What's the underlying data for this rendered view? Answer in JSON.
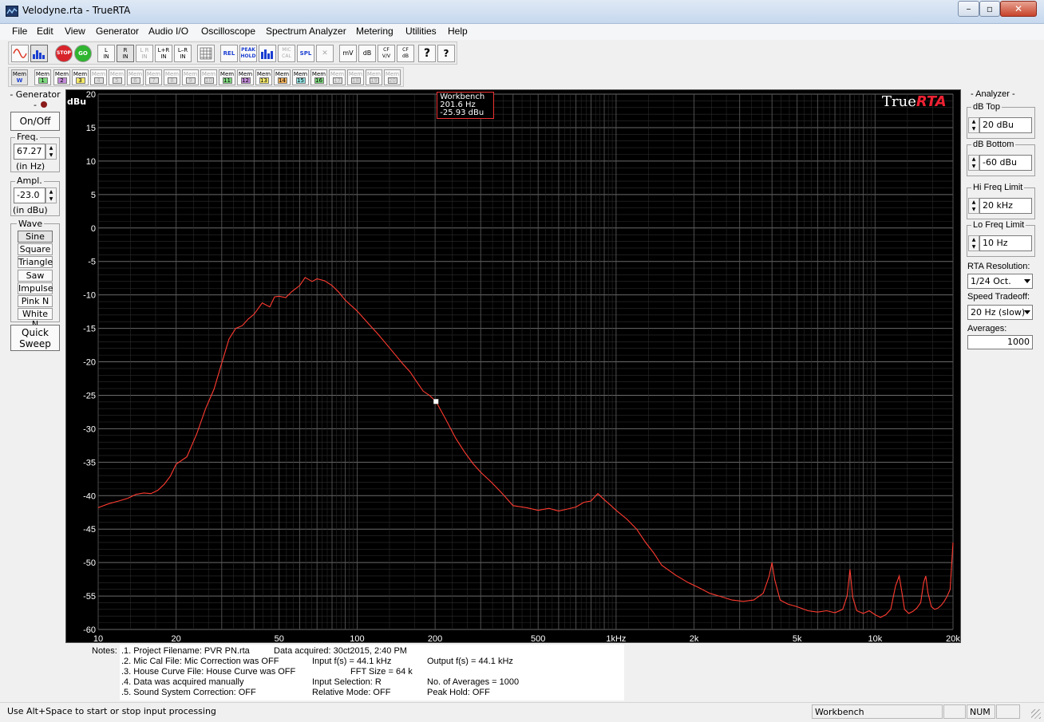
{
  "window": {
    "title": "Velodyne.rta - TrueRTA",
    "controls": [
      "–",
      "▫",
      "✕"
    ]
  },
  "menu": [
    {
      "label": "File",
      "key": "F"
    },
    {
      "label": "Edit",
      "key": "E"
    },
    {
      "label": "View",
      "key": "V"
    },
    {
      "label": "Generator",
      "key": "G"
    },
    {
      "label": "Audio I/O",
      "key": "A"
    },
    {
      "label": "Oscilloscope",
      "key": "O"
    },
    {
      "label": "Spectrum Analyzer",
      "key": "S"
    },
    {
      "label": "Metering",
      "key": "M"
    },
    {
      "label": "Utilities",
      "key": "U"
    },
    {
      "label": "Help",
      "key": "H"
    }
  ],
  "toolbar": {
    "stop": "STOP",
    "go": "GO",
    "l_in": [
      "L",
      "IN"
    ],
    "r_in": [
      "R",
      "IN"
    ],
    "lr_in": [
      "L R",
      "IN"
    ],
    "lpr_in": [
      "L+R",
      "IN"
    ],
    "lmr_in": [
      "L–R",
      "IN"
    ],
    "rel": "REL",
    "peak_hold": [
      "PEAK",
      "HOLD"
    ],
    "mic_cal": [
      "MIC",
      "CAL"
    ],
    "spl": "SPL",
    "mv": "mV",
    "db": "dB",
    "cf_vv": [
      "CF",
      "V/V"
    ],
    "cf_db": [
      "CF",
      "dB"
    ],
    "help": "?",
    "context_help": "?"
  },
  "memories": {
    "label": "Mem",
    "items": [
      {
        "num": "W",
        "color": "#ffffff",
        "enabled": true
      },
      {
        "num": "1",
        "color": "#7dd87d",
        "enabled": true
      },
      {
        "num": "2",
        "color": "#c28ad8",
        "enabled": true
      },
      {
        "num": "3",
        "color": "#f4e86a",
        "enabled": true
      },
      {
        "num": "4",
        "color": "#e0e0e0",
        "enabled": false
      },
      {
        "num": "5",
        "color": "#e0e0e0",
        "enabled": false
      },
      {
        "num": "6",
        "color": "#e0e0e0",
        "enabled": false
      },
      {
        "num": "7",
        "color": "#e0e0e0",
        "enabled": false
      },
      {
        "num": "8",
        "color": "#e0e0e0",
        "enabled": false
      },
      {
        "num": "9",
        "color": "#e0e0e0",
        "enabled": false
      },
      {
        "num": "10",
        "color": "#e0e0e0",
        "enabled": false
      },
      {
        "num": "11",
        "color": "#7dd87d",
        "enabled": true
      },
      {
        "num": "12",
        "color": "#c28ad8",
        "enabled": true
      },
      {
        "num": "13",
        "color": "#f4e86a",
        "enabled": true
      },
      {
        "num": "14",
        "color": "#f2b15a",
        "enabled": true
      },
      {
        "num": "15",
        "color": "#8fe0e0",
        "enabled": true
      },
      {
        "num": "16",
        "color": "#7dd87d",
        "enabled": true
      },
      {
        "num": "17",
        "color": "#e0e0e0",
        "enabled": false
      },
      {
        "num": "18",
        "color": "#e0e0e0",
        "enabled": false
      },
      {
        "num": "19",
        "color": "#e0e0e0",
        "enabled": false
      },
      {
        "num": "20",
        "color": "#e0e0e0",
        "enabled": false
      }
    ]
  },
  "generator": {
    "title": "- Generator -",
    "on_off": "On/Off",
    "freq_label": "Freq.",
    "freq_value": "67.27",
    "freq_unit": "(in Hz)",
    "ampl_label": "Ampl.",
    "ampl_value": "-23.0",
    "ampl_unit": "(in dBu)",
    "wave_label": "Wave",
    "waves": [
      "Sine",
      "Square",
      "Triangle",
      "Saw",
      "Impulse",
      "Pink N",
      "White N"
    ],
    "selected_wave": "Sine",
    "quick_sweep": [
      "Quick",
      "Sweep"
    ]
  },
  "analyzer": {
    "title": "- Analyzer -",
    "db_top_label": "dB Top",
    "db_top_value": "20 dBu",
    "db_bottom_label": "dB Bottom",
    "db_bottom_value": "-60 dBu",
    "hi_freq_label": "Hi Freq Limit",
    "hi_freq_value": "20 kHz",
    "lo_freq_label": "Lo Freq Limit",
    "lo_freq_value": "10 Hz",
    "rta_res_label": "RTA Resolution:",
    "rta_res_value": "1/24 Oct.",
    "speed_label": "Speed Tradeoff:",
    "speed_value": "20 Hz (slow)",
    "averages_label": "Averages:",
    "averages_value": "1000"
  },
  "chart_data": {
    "type": "line",
    "yunit": "dBu",
    "logo": {
      "true": "True",
      "rta": "RTA"
    },
    "ylim": [
      -60,
      20
    ],
    "xlim": [
      10,
      20000
    ],
    "xscale": "log",
    "grid": true,
    "background": "#000000",
    "line_color": "#ff3b30",
    "y_ticks": [
      20,
      15,
      10,
      5,
      0,
      -5,
      -10,
      -15,
      -20,
      -25,
      -30,
      -35,
      -40,
      -45,
      -50,
      -55,
      -60
    ],
    "x_ticks": [
      {
        "v": 10,
        "label": "10"
      },
      {
        "v": 20,
        "label": "20"
      },
      {
        "v": 50,
        "label": "50"
      },
      {
        "v": 100,
        "label": "100"
      },
      {
        "v": 200,
        "label": "200"
      },
      {
        "v": 500,
        "label": "500"
      },
      {
        "v": 1000,
        "label": "1kHz"
      },
      {
        "v": 2000,
        "label": "2k"
      },
      {
        "v": 5000,
        "label": "5k"
      },
      {
        "v": 10000,
        "label": "10k"
      },
      {
        "v": 20000,
        "label": "20k"
      }
    ],
    "cursor": {
      "name": "Workbench",
      "freq_text": "201.6 Hz",
      "level_text": "-25.93 dBu",
      "x": 201.6,
      "y": -25.93
    },
    "series": [
      {
        "name": "Workbench",
        "x": [
          10,
          11,
          12,
          13,
          14,
          15,
          16,
          17,
          18,
          19,
          20,
          22,
          24,
          26,
          28,
          30,
          32,
          34,
          36,
          38,
          40,
          43,
          46,
          48,
          50,
          53,
          56,
          60,
          63,
          67,
          70,
          75,
          80,
          85,
          90,
          100,
          110,
          120,
          130,
          140,
          150,
          160,
          170,
          180,
          190,
          201.6,
          220,
          240,
          260,
          280,
          300,
          330,
          360,
          400,
          450,
          500,
          550,
          600,
          650,
          700,
          750,
          800,
          850,
          900,
          950,
          1000,
          1100,
          1200,
          1300,
          1400,
          1500,
          1700,
          1900,
          2100,
          2300,
          2500,
          2800,
          3100,
          3400,
          3700,
          3900,
          4000,
          4100,
          4300,
          4600,
          5000,
          5500,
          6000,
          6500,
          7000,
          7500,
          7800,
          8000,
          8200,
          8500,
          9000,
          9500,
          10000,
          10500,
          11000,
          11500,
          12000,
          12400,
          12700,
          13000,
          13500,
          14000,
          14500,
          15000,
          15400,
          15700,
          16000,
          16500,
          17000,
          17500,
          18000,
          18500,
          19000,
          19500,
          20000
        ],
        "values": [
          -41.8,
          -41.2,
          -40.8,
          -40.4,
          -39.8,
          -39.6,
          -39.7,
          -39.2,
          -38.3,
          -37.1,
          -35.3,
          -34.2,
          -30.8,
          -27.0,
          -24.1,
          -20.2,
          -16.6,
          -15.0,
          -14.6,
          -13.6,
          -12.9,
          -11.2,
          -11.8,
          -10.3,
          -10.2,
          -10.4,
          -9.5,
          -8.6,
          -7.4,
          -8.0,
          -7.6,
          -7.9,
          -8.6,
          -9.6,
          -10.8,
          -12.4,
          -14.2,
          -15.8,
          -17.4,
          -18.9,
          -20.3,
          -21.5,
          -23.0,
          -24.4,
          -25.0,
          -25.93,
          -28.6,
          -31.4,
          -33.5,
          -35.2,
          -36.5,
          -38.0,
          -39.5,
          -41.5,
          -41.8,
          -42.2,
          -41.9,
          -42.3,
          -42.0,
          -41.7,
          -41.0,
          -40.8,
          -39.7,
          -40.6,
          -41.4,
          -42.2,
          -43.5,
          -45.0,
          -47.0,
          -48.6,
          -50.4,
          -51.9,
          -53.0,
          -53.8,
          -54.6,
          -55.0,
          -55.6,
          -55.8,
          -55.6,
          -54.6,
          -52.0,
          -50.0,
          -52.6,
          -55.6,
          -56.2,
          -56.6,
          -57.2,
          -57.4,
          -57.2,
          -57.5,
          -57.0,
          -55.0,
          -51.0,
          -55.2,
          -57.2,
          -57.6,
          -57.2,
          -57.8,
          -58.2,
          -57.8,
          -57.0,
          -53.5,
          -52.0,
          -54.5,
          -57.0,
          -57.6,
          -57.3,
          -56.8,
          -56.0,
          -53.0,
          -52.0,
          -54.5,
          -56.6,
          -57.0,
          -56.8,
          -56.4,
          -55.8,
          -55.0,
          -54.0,
          -47.0
        ]
      }
    ]
  },
  "notes": {
    "label": "Notes:",
    "col1": [
      ".1. Project Filename: PVR PN.rta",
      ".2. Mic Cal File: Mic Correction was OFF",
      ".3. House Curve File: House Curve was OFF",
      ".4. Data was acquired manually",
      ".5. Sound System Correction: OFF"
    ],
    "acquired": "Data acquired:  30ct2015, 2:40 PM",
    "input_fs": "Input f(s) = 44.1 kHz",
    "fft_size": "FFT Size = 64 k",
    "input_sel": "Input Selection: R",
    "rel_mode": "Relative Mode:  OFF",
    "output_fs": "Output f(s) = 44.1 kHz",
    "averages": "No. of Averages = 1000",
    "peak_hold": "Peak Hold: OFF"
  },
  "status": {
    "hint": "Use Alt+Space to start or stop input processing",
    "memory": "Workbench",
    "num": "NUM"
  }
}
